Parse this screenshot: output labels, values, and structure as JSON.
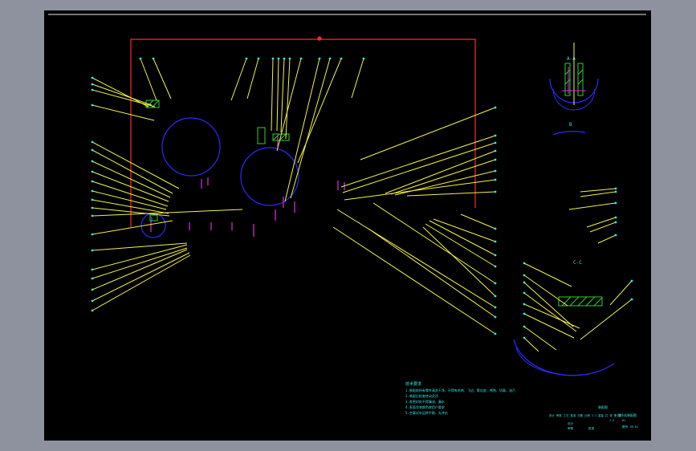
{
  "colors": {
    "frame_background": "#8d929e",
    "sheet_background": "#000000",
    "border_line": "#e8e8e8",
    "outline_red": "#ff2a2a",
    "leader_yellow": "#f2f24a",
    "callout_cyan": "#35e6e6",
    "circle_blue": "#2a2aff",
    "hatch_green": "#2fd02f",
    "marker_magenta": "#e22ae2"
  },
  "notes": {
    "heading": "技术要求",
    "lines": [
      "1.装配前所有零件清洗干净，不得有毛刺、飞边、氧化皮、锈蚀、切屑、油污",
      "2.装配后检查转动灵活",
      "3.各密封处不得漏油、漏水",
      "4.表面涂漆颜色按用户要求",
      "5.空载试车运转平稳、无冲击"
    ]
  },
  "title_block": {
    "top_label": "装配图",
    "drawing_title": "搅拌站装配图",
    "row1": "设计 审核 工艺 批准 日期 比例 1:1 重量 共 张 第 张",
    "scale": "1:1",
    "sheet_no": "01",
    "col_left": "设计",
    "col_mid": "审核",
    "col_right": "批准",
    "bottom_right": "图号 JB-01"
  },
  "view_labels": {
    "section_a": "A-A",
    "section_b": "B",
    "section_c": "C-C",
    "part_label": "1"
  }
}
